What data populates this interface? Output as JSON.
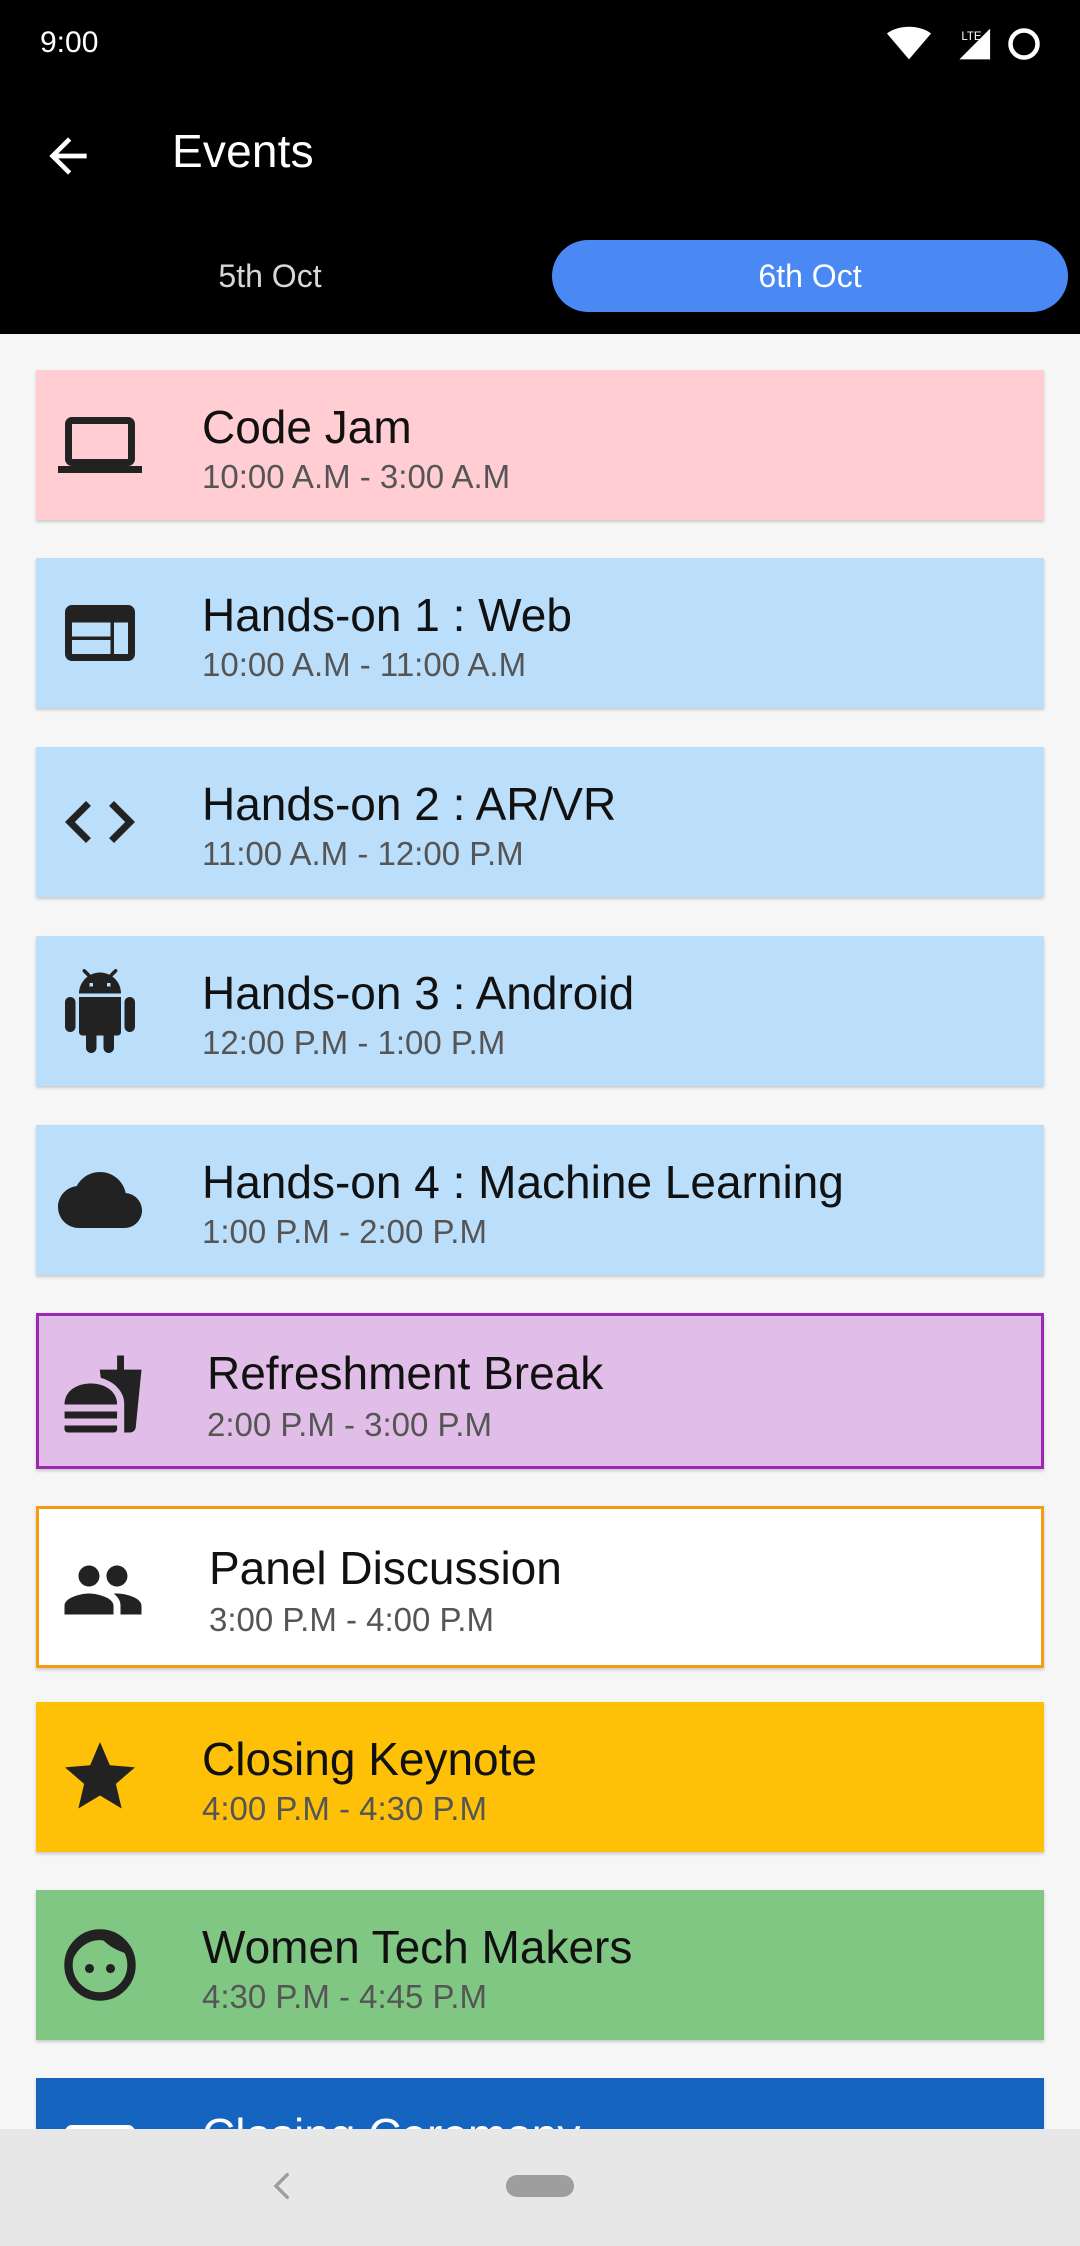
{
  "status": {
    "time": "9:00",
    "network": "LTE"
  },
  "appbar": {
    "title": "Events"
  },
  "tabs": [
    {
      "label": "5th Oct",
      "selected": false
    },
    {
      "label": "6th Oct",
      "selected": true
    }
  ],
  "events": [
    {
      "name": "Code Jam",
      "time": "10:00 A.M - 3:00 A.M",
      "icon": "laptop-icon",
      "bg": "#ffcdd2",
      "border": ""
    },
    {
      "name": "Hands-on 1 : Web",
      "time": "10:00 A.M - 11:00 A.M",
      "icon": "web-layout-icon",
      "bg": "#bbdefb",
      "border": ""
    },
    {
      "name": "Hands-on 2 : AR/VR",
      "time": "11:00 A.M - 12:00 P.M",
      "icon": "code-icon",
      "bg": "#bbdefb",
      "border": ""
    },
    {
      "name": "Hands-on 3 : Android",
      "time": "12:00 P.M - 1:00 P.M",
      "icon": "android-icon",
      "bg": "#bbdefb",
      "border": ""
    },
    {
      "name": "Hands-on 4 : Machine Learning",
      "time": "1:00 P.M - 2:00 P.M",
      "icon": "cloud-icon",
      "bg": "#bbdefb",
      "border": ""
    },
    {
      "name": "Refreshment Break",
      "time": "2:00 P.M - 3:00 P.M",
      "icon": "fastfood-icon",
      "bg": "#e1bee7",
      "border": "#9c27b0"
    },
    {
      "name": "Panel Discussion",
      "time": "3:00 P.M - 4:00 P.M",
      "icon": "people-icon",
      "bg": "#ffffff",
      "border": "#f39c12"
    },
    {
      "name": "Closing Keynote",
      "time": "4:00 P.M - 4:30 P.M",
      "icon": "star-icon",
      "bg": "#ffc107",
      "border": ""
    },
    {
      "name": "Women Tech Makers",
      "time": "4:30 P.M - 4:45 P.M",
      "icon": "face-icon",
      "bg": "#81c784",
      "border": ""
    },
    {
      "name": "Closing Ceremony",
      "time": "",
      "icon": "card-icon",
      "bg": "#1565c0",
      "border": ""
    }
  ]
}
